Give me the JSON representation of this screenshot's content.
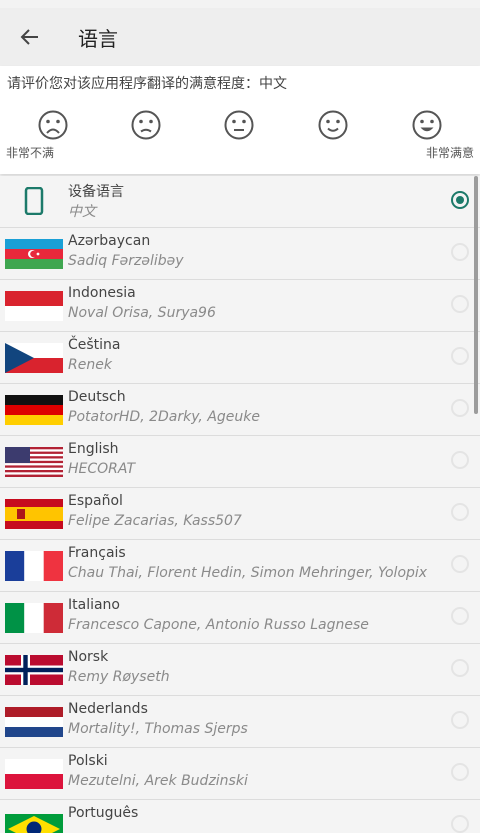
{
  "header": {
    "title": "语言",
    "back_icon": "arrow-left-icon"
  },
  "rating": {
    "question": "请评价您对该应用程序翻译的满意程度：中文",
    "low_label": "非常不满",
    "high_label": "非常满意",
    "faces": [
      "very-sad-face-icon",
      "sad-face-icon",
      "neutral-face-icon",
      "smile-face-icon",
      "happy-face-icon"
    ]
  },
  "languages": [
    {
      "name": "设备语言",
      "translators": "中文",
      "icon": "phone-icon",
      "selected": true
    },
    {
      "name": "Azərbaycan",
      "translators": "Sadiq Fərzəlibəy",
      "icon": "flag-azerbaijan-icon"
    },
    {
      "name": "Indonesia",
      "translators": "Noval Orisa, Surya96",
      "icon": "flag-indonesia-icon"
    },
    {
      "name": "Čeština",
      "translators": "Renek",
      "icon": "flag-czech-icon"
    },
    {
      "name": "Deutsch",
      "translators": "PotatorHD, 2Darky, Ageuke",
      "icon": "flag-germany-icon"
    },
    {
      "name": "English",
      "translators": "HECORAT",
      "icon": "flag-usa-icon"
    },
    {
      "name": "Español",
      "translators": "Felipe Zacarias, Kass507",
      "icon": "flag-spain-icon"
    },
    {
      "name": "Français",
      "translators": "Chau Thai, Florent Hedin, Simon Mehringer, Yolopix",
      "icon": "flag-france-icon"
    },
    {
      "name": "Italiano",
      "translators": "Francesco Capone, Antonio Russo Lagnese",
      "icon": "flag-italy-icon"
    },
    {
      "name": "Norsk",
      "translators": "Remy Røyseth",
      "icon": "flag-norway-icon"
    },
    {
      "name": "Nederlands",
      "translators": "Mortality!, Thomas Sjerps",
      "icon": "flag-netherlands-icon"
    },
    {
      "name": "Polski",
      "translators": "Mezutelni, Arek Budzinski",
      "icon": "flag-poland-icon"
    },
    {
      "name": "Português",
      "translators": "",
      "icon": "flag-brazil-icon"
    }
  ],
  "colors": {
    "accent": "#1c7a6a"
  }
}
